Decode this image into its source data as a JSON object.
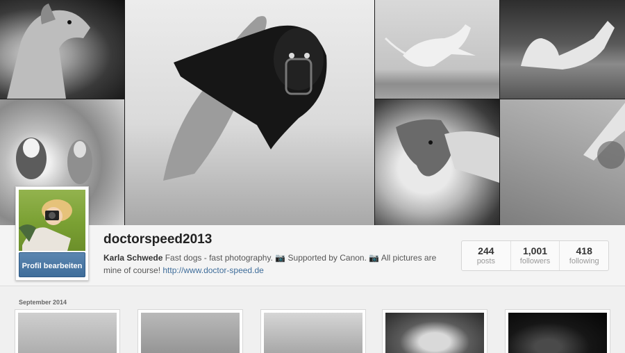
{
  "profile": {
    "username": "doctorspeed2013",
    "full_name": "Karla Schwede",
    "bio_text": " Fast dogs - fast photography. 📷 Supported by Canon. 📷 All pictures are mine of course! ",
    "website": "http://www.doctor-speed.de",
    "edit_button_label": "Profil bearbeiten",
    "accent_color": "#3f6d9a"
  },
  "stats": [
    {
      "value": "244",
      "label": "posts"
    },
    {
      "value": "1,001",
      "label": "followers"
    },
    {
      "value": "418",
      "label": "following"
    }
  ],
  "timeline": {
    "month_label": "September 2014"
  },
  "cover": {
    "icon_names": [
      "whippet-portrait",
      "dogs-running-water",
      "racing-greyhounds-muzzle",
      "dog-jumping",
      "dog-rolling-grass",
      "dog-on-sheepskin",
      "dog-leg-sand"
    ]
  }
}
